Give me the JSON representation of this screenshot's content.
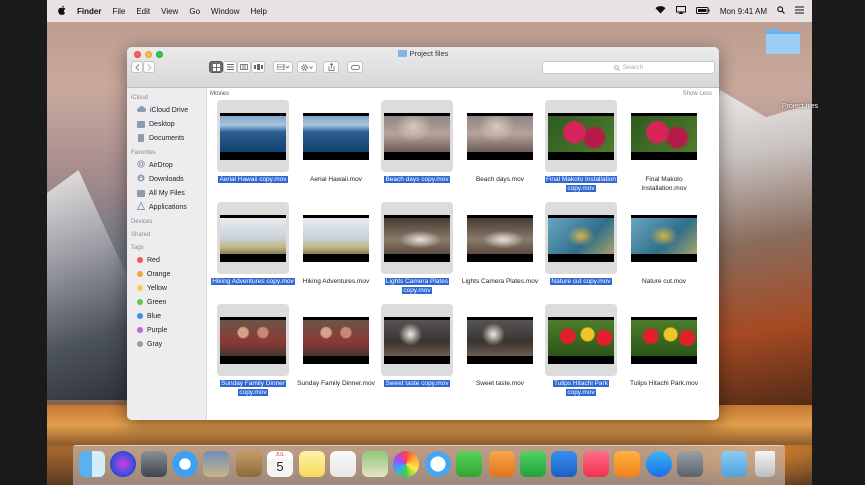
{
  "menubar": {
    "apple": "",
    "app": "Finder",
    "items": [
      "File",
      "Edit",
      "View",
      "Go",
      "Window",
      "Help"
    ],
    "clock": "Mon 9:41 AM",
    "status_icons": [
      "wifi-icon",
      "airplay-icon",
      "battery-icon",
      "spotlight-icon",
      "notification-center-icon"
    ]
  },
  "desktop_folder": {
    "label": "Project files",
    "color": "#8ec4ef"
  },
  "window": {
    "title": "Project files",
    "search_placeholder": "Search",
    "section_header": "Movies",
    "show_less": "Show Less"
  },
  "sidebar": {
    "sections": [
      {
        "title": "iCloud",
        "items": [
          {
            "label": "iCloud Drive",
            "icon": "cloud-icon"
          },
          {
            "label": "Desktop",
            "icon": "desktop-icon"
          },
          {
            "label": "Documents",
            "icon": "documents-icon"
          }
        ]
      },
      {
        "title": "Favorites",
        "items": [
          {
            "label": "AirDrop",
            "icon": "airdrop-icon"
          },
          {
            "label": "Downloads",
            "icon": "downloads-icon"
          },
          {
            "label": "All My Files",
            "icon": "all-files-icon"
          },
          {
            "label": "Applications",
            "icon": "applications-icon"
          }
        ]
      },
      {
        "title": "Devices",
        "items": []
      },
      {
        "title": "Shared",
        "items": []
      },
      {
        "title": "Tags",
        "items": [
          {
            "label": "Red",
            "color": "#ec5b56"
          },
          {
            "label": "Orange",
            "color": "#f5a33a"
          },
          {
            "label": "Yellow",
            "color": "#f1d13c"
          },
          {
            "label": "Green",
            "color": "#5cc94e"
          },
          {
            "label": "Blue",
            "color": "#3f8ef0"
          },
          {
            "label": "Purple",
            "color": "#b66bd6"
          },
          {
            "label": "Gray",
            "color": "#9b9b9b"
          }
        ]
      }
    ]
  },
  "files": [
    {
      "name": "Aerial Hawaii copy.mov",
      "selected": true,
      "theme": "aerial"
    },
    {
      "name": "Aerial Hawaii.mov",
      "selected": false,
      "theme": "aerial"
    },
    {
      "name": "Beach days copy.mov",
      "selected": true,
      "theme": "beach"
    },
    {
      "name": "Beach days.mov",
      "selected": false,
      "theme": "beach"
    },
    {
      "name": "Final Makoto Installation copy.mov",
      "selected": true,
      "theme": "flowers"
    },
    {
      "name": "Final Makoto Installation.mov",
      "selected": false,
      "theme": "flowers"
    },
    {
      "name": "Hiking Adventures copy.mov",
      "selected": true,
      "theme": "birds"
    },
    {
      "name": "Hiking Adventures.mov",
      "selected": false,
      "theme": "birds"
    },
    {
      "name": "Lights Camera Plates copy.mov",
      "selected": true,
      "theme": "plates"
    },
    {
      "name": "Lights Camera Plates.mov",
      "selected": false,
      "theme": "plates"
    },
    {
      "name": "Nature cut copy.mov",
      "selected": true,
      "theme": "nature"
    },
    {
      "name": "Nature cut.mov",
      "selected": false,
      "theme": "nature"
    },
    {
      "name": "Sunday Family Dinner copy.mov",
      "selected": true,
      "theme": "dinner"
    },
    {
      "name": "Sunday Family Dinner.mov",
      "selected": false,
      "theme": "dinner"
    },
    {
      "name": "Sweet taste copy.mov",
      "selected": true,
      "theme": "sweet"
    },
    {
      "name": "Sweet taste.mov",
      "selected": false,
      "theme": "sweet"
    },
    {
      "name": "Tulips Hitachi Park copy.mov",
      "selected": true,
      "theme": "tulips"
    },
    {
      "name": "Tulips Hitachi Park.mov",
      "selected": false,
      "theme": "tulips"
    }
  ],
  "dock": {
    "calendar_day": "5",
    "calendar_month": "JUL",
    "apps": [
      "finder-icon",
      "siri-icon",
      "launchpad-icon",
      "safari-icon",
      "photo-preview-icon",
      "contacts-icon",
      "calendar-icon",
      "notes-icon",
      "reminders-icon",
      "maps-icon",
      "photos-icon",
      "messages-icon",
      "facetime-icon",
      "pages-icon",
      "numbers-icon",
      "keynote-icon",
      "music-icon",
      "books-icon",
      "app-store-icon",
      "system-preferences-icon",
      "downloads-stack-icon",
      "trash-icon"
    ]
  },
  "colors": {
    "selection": "#2f68d3",
    "sidebar_bg": "#eeecef"
  }
}
